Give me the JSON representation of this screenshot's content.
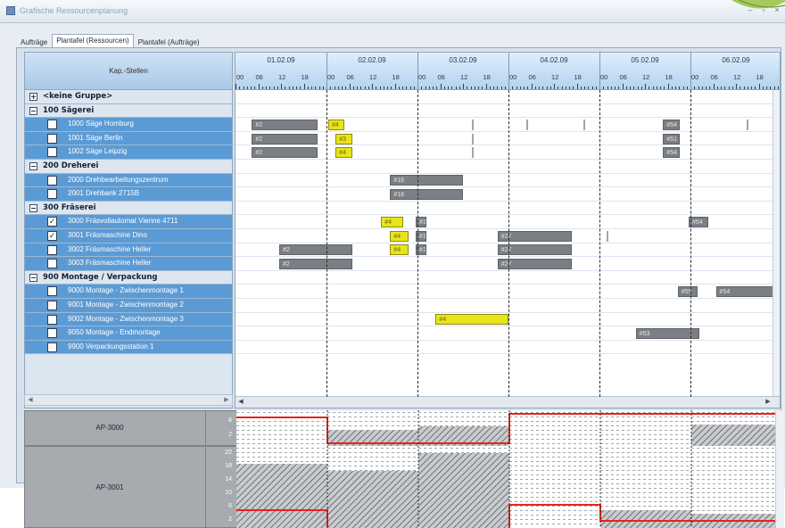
{
  "window": {
    "title": "Grafische Ressourcenplanung",
    "controls": [
      "–",
      "▫",
      "×"
    ]
  },
  "tabs": [
    "Aufträge",
    "Plantafel (Ressourcen)",
    "Plantafel (Aufträge)"
  ],
  "active_tab": 1,
  "tree": {
    "header": "Kap.-Stellen",
    "rows": [
      {
        "type": "group",
        "label": "<keine Gruppe>",
        "expand": "+"
      },
      {
        "type": "group",
        "label": "100 Sägerei",
        "expand": "−"
      },
      {
        "type": "item",
        "label": "1000 Säge Homburg",
        "checked": false
      },
      {
        "type": "item",
        "label": "1001 Säge Berlin",
        "checked": false
      },
      {
        "type": "item",
        "label": "1002 Säge Leipzig",
        "checked": false
      },
      {
        "type": "group",
        "label": "200 Dreherei",
        "expand": "−"
      },
      {
        "type": "item",
        "label": "2000 Drehbearbeitungszentrum",
        "checked": false
      },
      {
        "type": "item",
        "label": "2001 Drehbank 2715B",
        "checked": false
      },
      {
        "type": "group",
        "label": "300 Fräserei",
        "expand": "−"
      },
      {
        "type": "item",
        "label": "3000 Fräsvollautomat Vienne 4711",
        "checked": true
      },
      {
        "type": "item",
        "label": "3001 Fräsmaschine Dino",
        "checked": true
      },
      {
        "type": "item",
        "label": "3002 Fräsmaschine Heller",
        "checked": false
      },
      {
        "type": "item",
        "label": "3003 Fräsmaschine Heller",
        "checked": false
      },
      {
        "type": "group",
        "label": "900 Montage / Verpackung",
        "expand": "−"
      },
      {
        "type": "item",
        "label": "9000 Montage - Zwischenmontage 1",
        "checked": false
      },
      {
        "type": "item",
        "label": "9001 Montage - Zwischenmontage 2",
        "checked": false
      },
      {
        "type": "item",
        "label": "9002 Montage - Zwischenmontage 3",
        "checked": false
      },
      {
        "type": "item",
        "label": "9050 Montage - Endmontage",
        "checked": false
      },
      {
        "type": "item",
        "label": "9900 Verpackungsstation 1",
        "checked": false
      }
    ]
  },
  "timeline": {
    "dates": [
      "01.02.09",
      "02.02.09",
      "03.02.09",
      "04.02.09",
      "05.02.09",
      "06.02.09"
    ],
    "hours": [
      "00",
      "06",
      "12",
      "18"
    ]
  },
  "bars": [
    {
      "row": 2,
      "start": 0.18,
      "end": 0.9,
      "label": "#2",
      "color": "grey"
    },
    {
      "row": 2,
      "start": 1.02,
      "end": 1.2,
      "label": "#4",
      "color": "yellow"
    },
    {
      "row": 2,
      "start": 4.7,
      "end": 4.88,
      "label": "#54",
      "color": "grey"
    },
    {
      "row": 3,
      "start": 0.18,
      "end": 0.9,
      "label": "#2",
      "color": "grey"
    },
    {
      "row": 3,
      "start": 1.1,
      "end": 1.28,
      "label": "#3",
      "color": "yellow"
    },
    {
      "row": 3,
      "start": 4.7,
      "end": 4.88,
      "label": "#51",
      "color": "grey"
    },
    {
      "row": 4,
      "start": 0.18,
      "end": 0.9,
      "label": "#2",
      "color": "grey"
    },
    {
      "row": 4,
      "start": 1.1,
      "end": 1.28,
      "label": "#4",
      "color": "yellow"
    },
    {
      "row": 4,
      "start": 4.7,
      "end": 4.88,
      "label": "#54",
      "color": "grey"
    },
    {
      "row": 6,
      "start": 1.7,
      "end": 2.5,
      "label": "#18",
      "color": "grey"
    },
    {
      "row": 7,
      "start": 1.7,
      "end": 2.5,
      "label": "#18",
      "color": "grey"
    },
    {
      "row": 9,
      "start": 1.6,
      "end": 1.84,
      "label": "#4",
      "color": "yellow"
    },
    {
      "row": 9,
      "start": 1.98,
      "end": 2.1,
      "label": "#1",
      "color": "grey"
    },
    {
      "row": 9,
      "start": 4.98,
      "end": 5.2,
      "label": "#54",
      "color": "grey"
    },
    {
      "row": 10,
      "start": 1.7,
      "end": 1.9,
      "label": "#4",
      "color": "yellow"
    },
    {
      "row": 10,
      "start": 1.98,
      "end": 2.1,
      "label": "#1",
      "color": "grey"
    },
    {
      "row": 10,
      "start": 2.88,
      "end": 3.7,
      "label": "#27",
      "color": "grey"
    },
    {
      "row": 11,
      "start": 0.48,
      "end": 1.28,
      "label": "#2",
      "color": "grey"
    },
    {
      "row": 11,
      "start": 1.7,
      "end": 1.9,
      "label": "#4",
      "color": "yellow"
    },
    {
      "row": 11,
      "start": 1.98,
      "end": 2.1,
      "label": "#1",
      "color": "grey"
    },
    {
      "row": 11,
      "start": 2.88,
      "end": 3.7,
      "label": "#27",
      "color": "grey"
    },
    {
      "row": 12,
      "start": 0.48,
      "end": 1.28,
      "label": "#2",
      "color": "grey"
    },
    {
      "row": 12,
      "start": 2.88,
      "end": 3.7,
      "label": "#27",
      "color": "grey"
    },
    {
      "row": 14,
      "start": 4.86,
      "end": 5.08,
      "label": "#55",
      "color": "grey"
    },
    {
      "row": 14,
      "start": 5.28,
      "end": 5.98,
      "label": "#54",
      "color": "grey"
    },
    {
      "row": 16,
      "start": 2.2,
      "end": 3.0,
      "label": "#4",
      "color": "yellow"
    },
    {
      "row": 17,
      "start": 4.4,
      "end": 5.1,
      "label": "#53",
      "color": "grey"
    }
  ],
  "ticks": [
    {
      "row": 2,
      "pos": 2.6
    },
    {
      "row": 2,
      "pos": 3.2
    },
    {
      "row": 2,
      "pos": 3.82
    },
    {
      "row": 2,
      "pos": 5.62
    },
    {
      "row": 3,
      "pos": 2.6
    },
    {
      "row": 4,
      "pos": 2.6
    },
    {
      "row": 10,
      "pos": 4.08
    }
  ],
  "load": [
    {
      "label": "AP-3000",
      "axis": [
        "6",
        "2"
      ],
      "rows": 1
    },
    {
      "label": "AP-3001",
      "axis": [
        "22",
        "18",
        "14",
        "10",
        "6",
        "2"
      ],
      "rows": 2
    }
  ],
  "colors": {
    "bar_grey": "#7b7f84",
    "bar_yellow": "#e8e41a",
    "capacity_line": "#e8231b"
  }
}
